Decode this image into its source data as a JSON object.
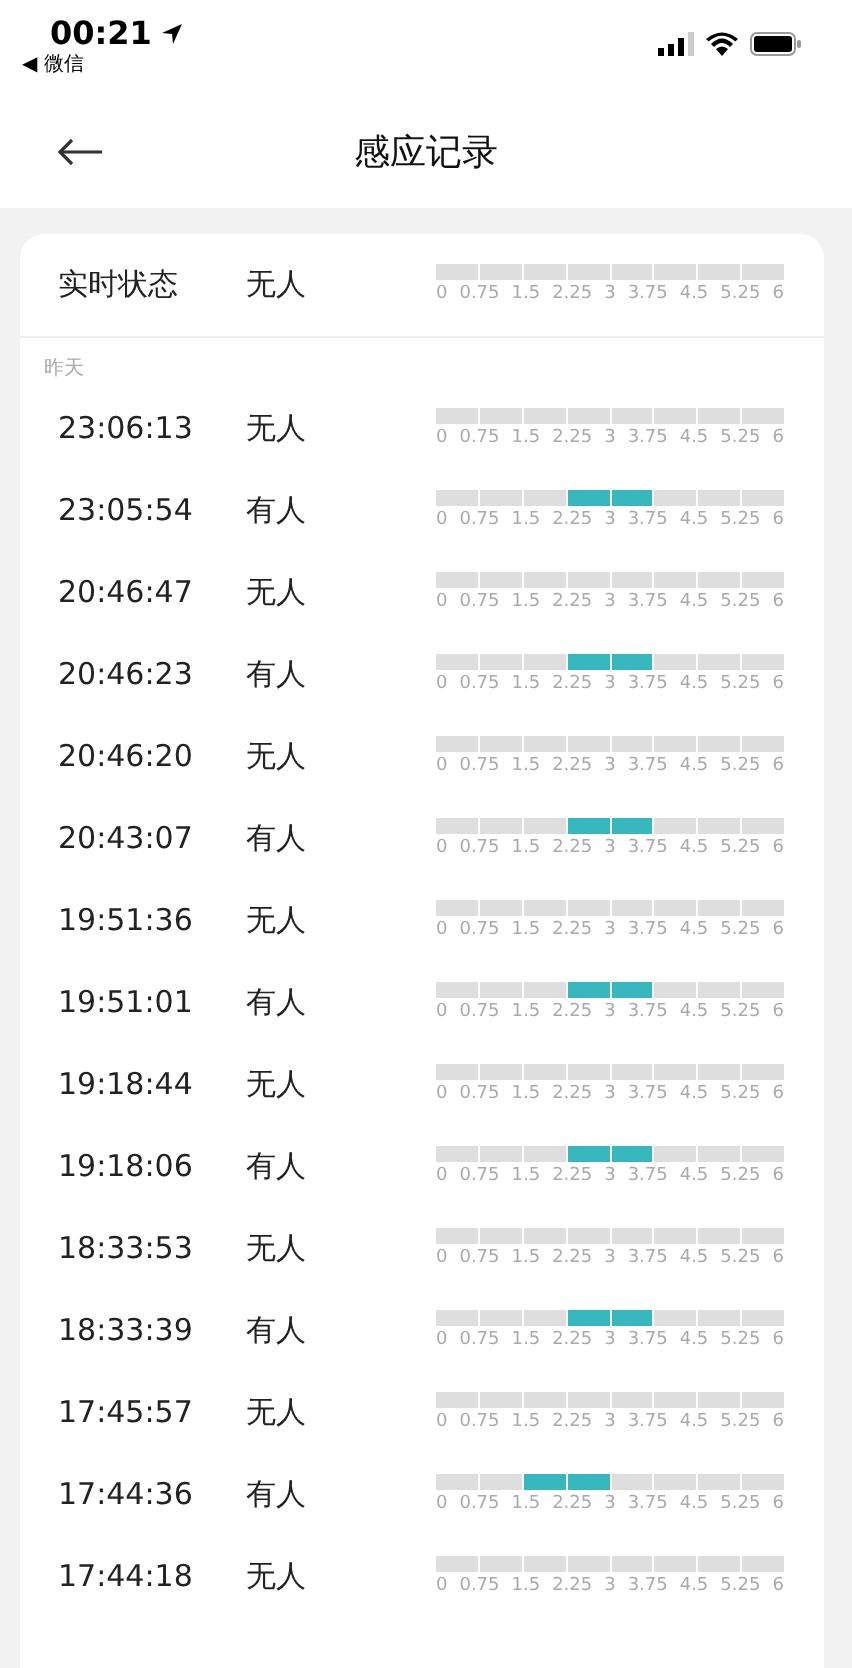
{
  "status_bar": {
    "time": "00:21",
    "back_app": "◀ 微信"
  },
  "header": {
    "title": "感应记录"
  },
  "realtime": {
    "label": "实时状态",
    "status": "无人",
    "segments": [
      false,
      false,
      false,
      false,
      false,
      false,
      false,
      false
    ],
    "ticks": [
      "0",
      "0.75",
      "1.5",
      "2.25",
      "3",
      "3.75",
      "4.5",
      "5.25",
      "6"
    ]
  },
  "section_label": "昨天",
  "records": [
    {
      "time": "23:06:13",
      "status": "无人",
      "segments": [
        false,
        false,
        false,
        false,
        false,
        false,
        false,
        false
      ],
      "ticks": [
        "0",
        "0.75",
        "1.5",
        "2.25",
        "3",
        "3.75",
        "4.5",
        "5.25",
        "6"
      ]
    },
    {
      "time": "23:05:54",
      "status": "有人",
      "segments": [
        false,
        false,
        false,
        true,
        true,
        false,
        false,
        false
      ],
      "ticks": [
        "0",
        "0.75",
        "1.5",
        "2.25",
        "3",
        "3.75",
        "4.5",
        "5.25",
        "6"
      ]
    },
    {
      "time": "20:46:47",
      "status": "无人",
      "segments": [
        false,
        false,
        false,
        false,
        false,
        false,
        false,
        false
      ],
      "ticks": [
        "0",
        "0.75",
        "1.5",
        "2.25",
        "3",
        "3.75",
        "4.5",
        "5.25",
        "6"
      ]
    },
    {
      "time": "20:46:23",
      "status": "有人",
      "segments": [
        false,
        false,
        false,
        true,
        true,
        false,
        false,
        false
      ],
      "ticks": [
        "0",
        "0.75",
        "1.5",
        "2.25",
        "3",
        "3.75",
        "4.5",
        "5.25",
        "6"
      ]
    },
    {
      "time": "20:46:20",
      "status": "无人",
      "segments": [
        false,
        false,
        false,
        false,
        false,
        false,
        false,
        false
      ],
      "ticks": [
        "0",
        "0.75",
        "1.5",
        "2.25",
        "3",
        "3.75",
        "4.5",
        "5.25",
        "6"
      ]
    },
    {
      "time": "20:43:07",
      "status": "有人",
      "segments": [
        false,
        false,
        false,
        true,
        true,
        false,
        false,
        false
      ],
      "ticks": [
        "0",
        "0.75",
        "1.5",
        "2.25",
        "3",
        "3.75",
        "4.5",
        "5.25",
        "6"
      ]
    },
    {
      "time": "19:51:36",
      "status": "无人",
      "segments": [
        false,
        false,
        false,
        false,
        false,
        false,
        false,
        false
      ],
      "ticks": [
        "0",
        "0.75",
        "1.5",
        "2.25",
        "3",
        "3.75",
        "4.5",
        "5.25",
        "6"
      ]
    },
    {
      "time": "19:51:01",
      "status": "有人",
      "segments": [
        false,
        false,
        false,
        true,
        true,
        false,
        false,
        false
      ],
      "ticks": [
        "0",
        "0.75",
        "1.5",
        "2.25",
        "3",
        "3.75",
        "4.5",
        "5.25",
        "6"
      ]
    },
    {
      "time": "19:18:44",
      "status": "无人",
      "segments": [
        false,
        false,
        false,
        false,
        false,
        false,
        false,
        false
      ],
      "ticks": [
        "0",
        "0.75",
        "1.5",
        "2.25",
        "3",
        "3.75",
        "4.5",
        "5.25",
        "6"
      ]
    },
    {
      "time": "19:18:06",
      "status": "有人",
      "segments": [
        false,
        false,
        false,
        true,
        true,
        false,
        false,
        false
      ],
      "ticks": [
        "0",
        "0.75",
        "1.5",
        "2.25",
        "3",
        "3.75",
        "4.5",
        "5.25",
        "6"
      ]
    },
    {
      "time": "18:33:53",
      "status": "无人",
      "segments": [
        false,
        false,
        false,
        false,
        false,
        false,
        false,
        false
      ],
      "ticks": [
        "0",
        "0.75",
        "1.5",
        "2.25",
        "3",
        "3.75",
        "4.5",
        "5.25",
        "6"
      ]
    },
    {
      "time": "18:33:39",
      "status": "有人",
      "segments": [
        false,
        false,
        false,
        true,
        true,
        false,
        false,
        false
      ],
      "ticks": [
        "0",
        "0.75",
        "1.5",
        "2.25",
        "3",
        "3.75",
        "4.5",
        "5.25",
        "6"
      ]
    },
    {
      "time": "17:45:57",
      "status": "无人",
      "segments": [
        false,
        false,
        false,
        false,
        false,
        false,
        false,
        false
      ],
      "ticks": [
        "0",
        "0.75",
        "1.5",
        "2.25",
        "3",
        "3.75",
        "4.5",
        "5.25",
        "6"
      ]
    },
    {
      "time": "17:44:36",
      "status": "有人",
      "segments": [
        false,
        false,
        true,
        true,
        false,
        false,
        false,
        false
      ],
      "ticks": [
        "0",
        "0.75",
        "1.5",
        "2.25",
        "3",
        "3.75",
        "4.5",
        "5.25",
        "6"
      ]
    },
    {
      "time": "17:44:18",
      "status": "无人",
      "segments": [
        false,
        false,
        false,
        false,
        false,
        false,
        false,
        false
      ],
      "ticks": [
        "0",
        "0.75",
        "1.5",
        "2.25",
        "3",
        "3.75",
        "4.5",
        "5.25",
        "6"
      ]
    }
  ]
}
